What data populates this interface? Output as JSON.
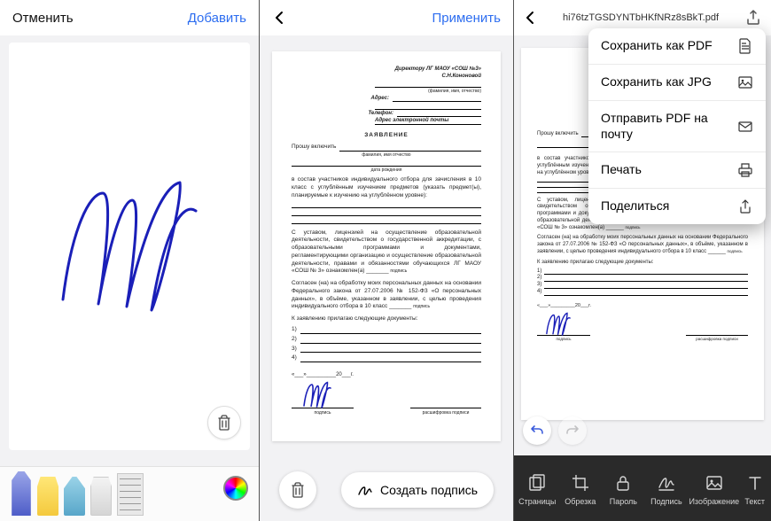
{
  "panel1": {
    "cancel": "Отменить",
    "add": "Добавить",
    "tools": {
      "pen": "pen",
      "highlighter": "highlighter",
      "pencil": "pencil",
      "eraser": "eraser",
      "ruler": "ruler",
      "color": "color-picker"
    }
  },
  "panel2": {
    "apply": "Применить",
    "create_signature": "Создать подпись"
  },
  "panel3": {
    "filename": "hi76tzTGSDYNTbHKfNRz8sBkT.pdf",
    "menu": {
      "save_pdf": "Сохранить как PDF",
      "save_jpg": "Сохранить как JPG",
      "send_mail": "Отправить PDF на почту",
      "print": "Печать",
      "share": "Поделиться"
    },
    "bar": {
      "pages": "Страницы",
      "crop": "Обрезка",
      "password": "Пароль",
      "sign": "Подпись",
      "image": "Изображение",
      "text": "Текст"
    }
  },
  "document": {
    "recipient_line": "Директору ЛГ МАОУ «СОШ №3»",
    "recipient_name": "С.Н.Кононовой",
    "fio_hint": "(фамилия, имя, отчество)",
    "address_label": "Адрес:",
    "phone_label": "Телефон:",
    "email_label": "Адрес электронной почты",
    "title": "ЗАЯВЛЕНИЕ",
    "include_label": "Прошу включить",
    "fio_caption": "фамилия, имя отчество",
    "dob_caption": "дата рождения",
    "para1": "в состав участников индивидуального отбора для зачисления в 10 класс с углублённым изучением предметов (указать предмет(ы), планируемые к изучению на углублённом уровне):",
    "para2": "С уставом, лицензией на осуществление образовательной деятельности, свидетельством о государственной аккредитации, с образовательными программами и документами, регламентирующими организацию и осуществление образовательной деятельности, правами и обязанностями обучающихся ЛГ МАОУ «СОШ № 3» ознакомлен(а)",
    "sig_small": "подпись",
    "para3": "Согласен (на) на обработку моих персональных данных на основании Федерального закона от 27.07.2006 № 152-ФЗ «О персональных данных», в объёме, указанном в заявлении, с целью проведения индивидуального отбора в 10 класс",
    "attach": "К заявлению прилагаю следующие документы:",
    "list": [
      "1)",
      "2)",
      "3)",
      "4)"
    ],
    "date_pre": "«___»",
    "date_mid": "20",
    "date_suf": "г.",
    "sig_caption_left": "подпись",
    "sig_caption_right": "расшифровка подписи"
  }
}
